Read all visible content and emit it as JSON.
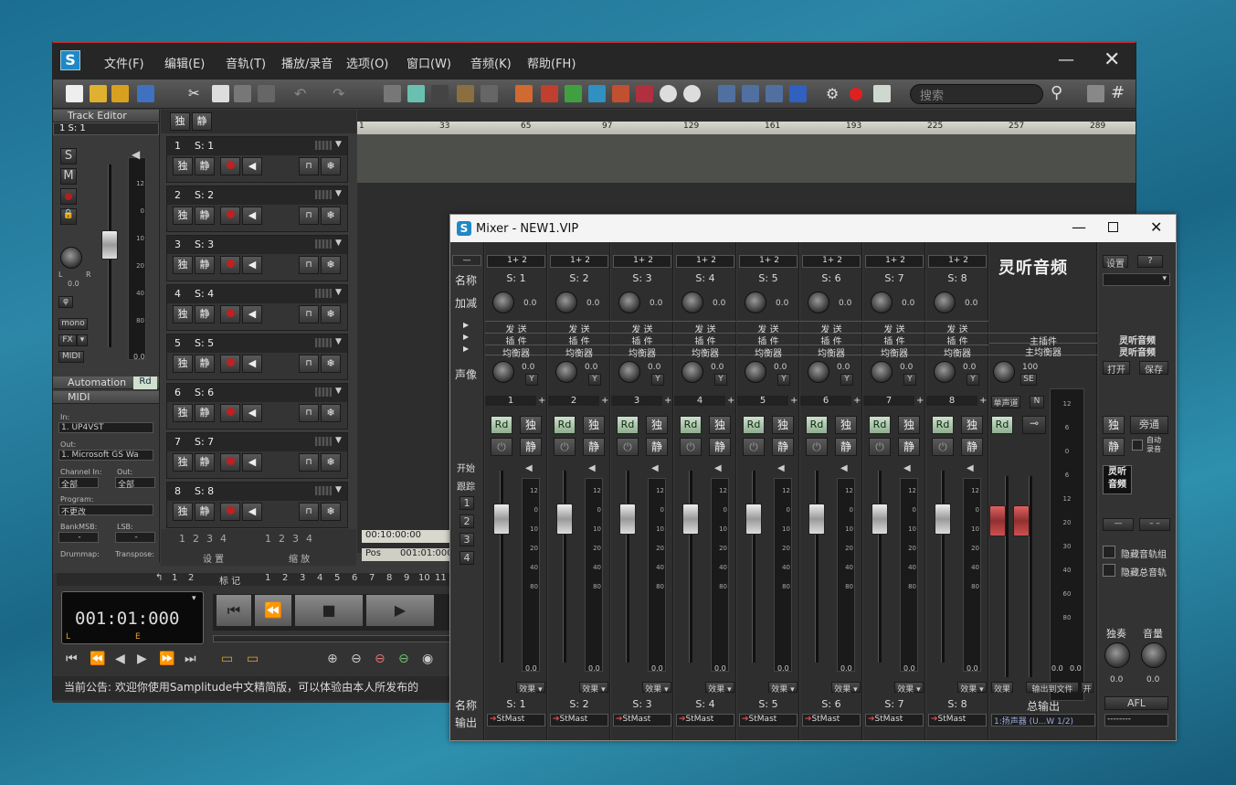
{
  "main": {
    "menu": [
      "文件(F)",
      "编辑(E)",
      "音轨(T)",
      "播放/录音",
      "选项(O)",
      "窗口(W)",
      "音频(K)",
      "帮助(FH)"
    ],
    "search_placeholder": "搜索",
    "track_editor": "Track Editor",
    "track_editor_sel": "1  S: 1",
    "solo": "独",
    "mute": "静",
    "left_buttons": {
      "s": "S",
      "m": "M",
      "phase": "φ",
      "mono": "mono",
      "fx": "FX",
      "midi": "MIDI"
    },
    "pan_labels": {
      "l": "L",
      "r": "R"
    },
    "pan_val": "0.0",
    "meter_scale": [
      "12",
      "0",
      "10",
      "20",
      "40",
      "80",
      "0.0"
    ],
    "automation": "Automation",
    "rd": "Rd",
    "midi": "MIDI",
    "midi_in_label": "In:",
    "midi_in": "1. UP4VST",
    "midi_out_label": "Out:",
    "midi_out": "1. Microsoft GS Wa",
    "channel_in_label": "Channel In:",
    "channel_out_label": "Out:",
    "channel_in": "全部",
    "channel_out": "全部",
    "program_label": "Program:",
    "program": "不更改",
    "bank_msb_label": "BankMSB:",
    "lsb_label": "LSB:",
    "bank_val": "-",
    "lsb_val": "-",
    "drummap_label": "Drummap:",
    "transpose_label": "Transpose:",
    "tracks": [
      {
        "num": "1",
        "name": "S: 1"
      },
      {
        "num": "2",
        "name": "S: 2"
      },
      {
        "num": "3",
        "name": "S: 3"
      },
      {
        "num": "4",
        "name": "S: 4"
      },
      {
        "num": "5",
        "name": "S: 5"
      },
      {
        "num": "6",
        "name": "S: 6"
      },
      {
        "num": "7",
        "name": "S: 7"
      },
      {
        "num": "8",
        "name": "S: 8"
      }
    ],
    "ruler": [
      "1",
      "33",
      "65",
      "97",
      "129",
      "161",
      "193",
      "225",
      "257",
      "289"
    ],
    "pager": [
      "1",
      "2",
      "3",
      "4"
    ],
    "set_label": "设 置",
    "zoom_label": "缩 放",
    "pos_time": "00:10:00:00",
    "pos_label": "Pos",
    "pos_value": "001:01:000",
    "marker_label": "标 记",
    "marker_nums": [
      "1",
      "2",
      "3",
      "4",
      "5",
      "6",
      "7",
      "8",
      "9",
      "10",
      "11"
    ],
    "loop_nums": [
      "1",
      "2"
    ],
    "lcd_time": "001:01:000",
    "lcd_l": "L",
    "lcd_e": "E",
    "status": "当前公告: 欢迎你使用Samplitude中文精简版，可以体验由本人所发布的"
  },
  "mixer": {
    "title": "Mixer - NEW1.VIP",
    "row_labels": {
      "name": "名称",
      "gain": "加减",
      "pan": "声像",
      "start": "开始",
      "track": "跟踪",
      "name2": "名称",
      "out": "输出"
    },
    "side_nums": [
      "1",
      "2",
      "3",
      "4"
    ],
    "routing": "1+ 2",
    "send": "发  送",
    "insert": "插  件",
    "eq": "均衡器",
    "knob_val": "0.0",
    "y": "Y",
    "rd": "Rd",
    "solo": "独",
    "mute": "静",
    "fx": "效果",
    "out": "StMast",
    "scale": [
      "12",
      "0",
      "10",
      "20",
      "40",
      "80",
      "0.0"
    ],
    "channels": [
      "S: 1",
      "S: 2",
      "S: 3",
      "S: 4",
      "S: 5",
      "S: 6",
      "S: 7",
      "S: 8"
    ],
    "channel_nums": [
      "1",
      "2",
      "3",
      "4",
      "5",
      "6",
      "7",
      "8"
    ],
    "master": {
      "logo": "灵听音频",
      "plugins": "主插件",
      "eq": "主均衡器",
      "pan_val": "100",
      "se": "SE",
      "mono": "单声道",
      "n": "N",
      "scale": [
        "12",
        "6",
        "0",
        "6",
        "12",
        "20",
        "30",
        "40",
        "60",
        "80",
        "0.0"
      ],
      "fx": "效果",
      "export": "输出到文件",
      "on": "开",
      "name": "总输出",
      "out": "1:扬声器 (U...W 1/2)"
    },
    "right": {
      "settings": "设置",
      "help": "?",
      "brand1": "灵听音频",
      "brand2": "灵听音频",
      "open": "打开",
      "save": "保存",
      "solo": "独",
      "bypass": "旁通",
      "mute": "静",
      "autorec": "自动\n录音",
      "logo": "灵听\n音频",
      "minus1": "—",
      "minus2": "– –",
      "hide_tracks": "隐藏音轨组",
      "hide_master": "隐藏总音轨",
      "solo_label": "独奏",
      "vol_label": "音量",
      "v1": "0.0",
      "v2": "0.0",
      "afl": "AFL",
      "out": "--------"
    }
  }
}
